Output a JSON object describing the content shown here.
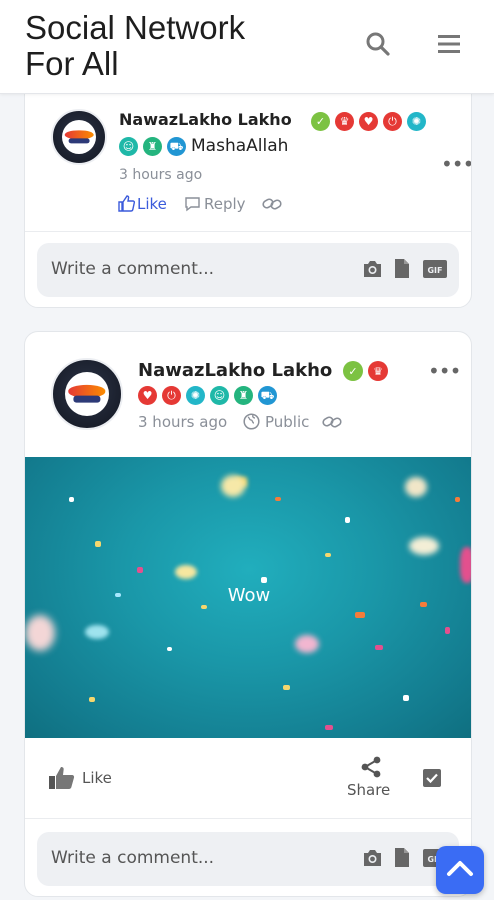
{
  "app": {
    "title": "Social Network For All",
    "title_line1": "Social Network",
    "title_line2": "For All"
  },
  "colors": {
    "accent": "#3a6cf4",
    "like_blue": "#3b5bdb",
    "verified_green": "#7cc242"
  },
  "comment_card": {
    "author": "NawazLakho Lakho",
    "message": "MashaAllah",
    "time": "3 hours ago",
    "like_label": "Like",
    "reply_label": "Reply",
    "comment_placeholder": "Write a comment..."
  },
  "post_card": {
    "author": "NawazLakho Lakho",
    "time": "3 hours ago",
    "privacy": "Public",
    "media_text": "Wow",
    "like_label": "Like",
    "share_label": "Share",
    "comment_placeholder": "Write a comment..."
  },
  "icons": [
    "search-icon",
    "menu-icon",
    "camera-icon",
    "file-icon",
    "gif-icon",
    "thumbs-up-icon",
    "share-icon",
    "checkbox-icon",
    "globe-icon",
    "link-icon",
    "chevron-up-icon"
  ]
}
